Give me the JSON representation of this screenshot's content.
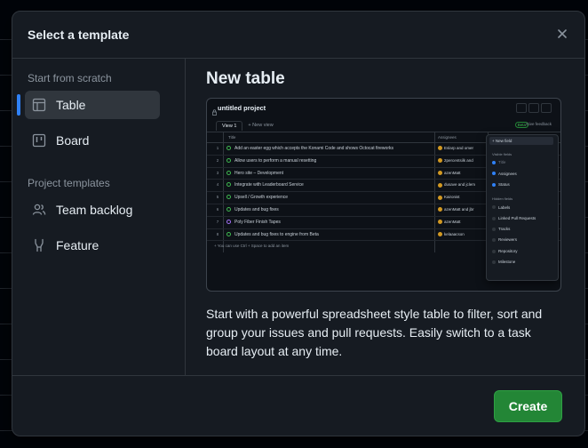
{
  "dialog": {
    "title": "Select a template",
    "close_icon": "close-icon"
  },
  "sidebar": {
    "section_scratch": "Start from scratch",
    "section_templates": "Project templates",
    "items": [
      {
        "label": "Table",
        "icon": "table-icon",
        "selected": true
      },
      {
        "label": "Board",
        "icon": "board-icon",
        "selected": false
      },
      {
        "label": "Team backlog",
        "icon": "people-icon",
        "selected": false
      },
      {
        "label": "Feature",
        "icon": "feature-icon",
        "selected": false
      }
    ]
  },
  "main": {
    "heading": "New table",
    "description": "Start with a powerful spreadsheet style table to filter, sort and group your issues and pull requests. Easily switch to a task board layout at any time."
  },
  "preview": {
    "project_title": "untitled project",
    "tab_view": "View 1",
    "tab_new": "+ New view",
    "beta": "Beta",
    "feedback": "Give feedback",
    "col_title": "Title",
    "col_assignees": "Assignees",
    "rows": [
      {
        "num": "1",
        "title": "Add an easter egg which accepts the Konami Code and shows Octocat fireworks",
        "assignee": "Eslarp and omer",
        "state": "open"
      },
      {
        "num": "2",
        "title": "Allow users to perform a manual resetting",
        "assignee": "2percentsilk and",
        "state": "open"
      },
      {
        "num": "3",
        "title": "Hero site – Development",
        "assignee": "azenMatt",
        "state": "open"
      },
      {
        "num": "4",
        "title": "Integrate with Leaderboard Service",
        "assignee": "dusave and jclem",
        "state": "open"
      },
      {
        "num": "5",
        "title": "Upsell / Growth experience",
        "assignee": "Kaironist",
        "state": "open"
      },
      {
        "num": "6",
        "title": "Updates and bug fixes",
        "assignee": "azenMatt and jbr",
        "state": "open"
      },
      {
        "num": "7",
        "title": "Poly Fiber Finish Tapes",
        "assignee": "azenMatt",
        "state": "done"
      },
      {
        "num": "8",
        "title": "Updates and bug fixes to engine from Beta",
        "assignee": "kelaaacson",
        "state": "open"
      }
    ],
    "add_item": "+   You can use  Ctrl + Space  to add an item",
    "menu": {
      "new_field": "+  New field",
      "visible_header": "Visible fields",
      "visible": [
        "Title",
        "Assignees",
        "Status"
      ],
      "hidden_header": "Hidden fields",
      "hidden": [
        "Labels",
        "Linked Pull Requests",
        "Tracks",
        "Reviewers",
        "Repository",
        "Milestone"
      ]
    }
  },
  "footer": {
    "create_label": "Create"
  },
  "colors": {
    "accent": "#2f81f7",
    "create_bg": "#238636",
    "dialog_bg": "#161b22"
  }
}
